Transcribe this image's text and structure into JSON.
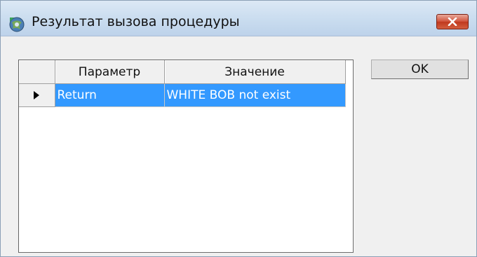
{
  "window": {
    "title": "Результат вызова процедуры",
    "icon": "gear-globe-app-icon",
    "close_icon": "close-x-icon"
  },
  "grid": {
    "columns": [
      "Параметр",
      "Значение"
    ],
    "rows": [
      {
        "parameter": "Return",
        "value": "WHITE BOB not exist",
        "selected": true
      }
    ],
    "current_row_indicator": "triangle-right-icon",
    "selection_color": "#3399ff"
  },
  "buttons": {
    "ok_label": "OK"
  }
}
